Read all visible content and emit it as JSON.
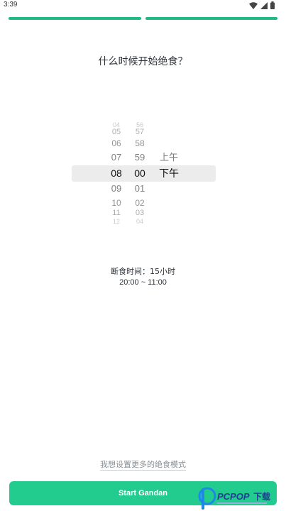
{
  "status_bar": {
    "time": "3:39"
  },
  "progress": {
    "segments": 2,
    "color": "#1fba85"
  },
  "question": "什么时候开始绝食？",
  "picker": {
    "hours": [
      {
        "label": "04"
      },
      {
        "label": "05"
      },
      {
        "label": "06"
      },
      {
        "label": "07"
      },
      {
        "label": "08",
        "selected": true
      },
      {
        "label": "09"
      },
      {
        "label": "10"
      },
      {
        "label": "11"
      },
      {
        "label": "12"
      }
    ],
    "minutes": [
      {
        "label": "56"
      },
      {
        "label": "57"
      },
      {
        "label": "58"
      },
      {
        "label": "59"
      },
      {
        "label": "00",
        "selected": true
      },
      {
        "label": "01"
      },
      {
        "label": "02"
      },
      {
        "label": "03"
      },
      {
        "label": "04"
      }
    ],
    "ampm": [
      {
        "label": "上午"
      },
      {
        "label": "下午",
        "selected": true
      }
    ]
  },
  "fast_info": {
    "duration": "断食时间：15小时",
    "range": "20:00 ~ 11:00"
  },
  "more_modes_link": "我想设置更多的绝食模式",
  "start_button": {
    "label": "Start Gandan",
    "color": "#22cc8f"
  },
  "watermark": {
    "text": "PCPOP下载"
  }
}
